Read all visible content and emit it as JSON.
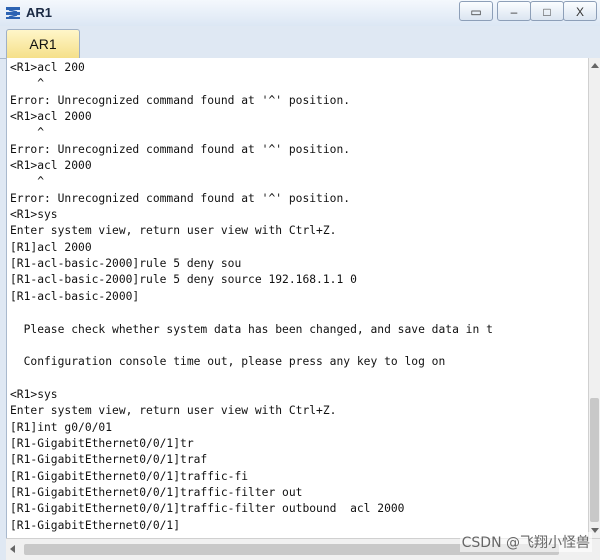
{
  "window": {
    "title": "AR1",
    "buttons": [
      "▭",
      "–",
      "□",
      "X"
    ]
  },
  "tabs": [
    {
      "label": "AR1"
    }
  ],
  "console": {
    "lines": [
      "<R1>acl 200",
      "    ^",
      "Error: Unrecognized command found at '^' position.",
      "<R1>acl 2000",
      "    ^",
      "Error: Unrecognized command found at '^' position.",
      "<R1>acl 2000",
      "    ^",
      "Error: Unrecognized command found at '^' position.",
      "<R1>sys",
      "Enter system view, return user view with Ctrl+Z.",
      "[R1]acl 2000",
      "[R1-acl-basic-2000]rule 5 deny sou",
      "[R1-acl-basic-2000]rule 5 deny source 192.168.1.1 0",
      "[R1-acl-basic-2000]",
      "",
      "  Please check whether system data has been changed, and save data in t",
      "",
      "  Configuration console time out, please press any key to log on",
      "",
      "<R1>sys",
      "Enter system view, return user view with Ctrl+Z.",
      "[R1]int g0/0/01",
      "[R1-GigabitEthernet0/0/1]tr",
      "[R1-GigabitEthernet0/0/1]traf",
      "[R1-GigabitEthernet0/0/1]traffic-fi",
      "[R1-GigabitEthernet0/0/1]traffic-filter out",
      "[R1-GigabitEthernet0/0/1]traffic-filter outbound  acl 2000",
      "[R1-GigabitEthernet0/0/1]"
    ]
  },
  "watermark": "CSDN @飞翔小怪兽"
}
